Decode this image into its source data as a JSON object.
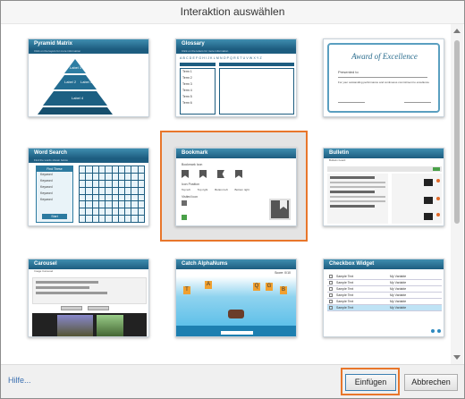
{
  "window": {
    "title": "Interaktion auswählen"
  },
  "tiles": [
    {
      "title": "Pyramid Matrix",
      "subtitle": "Click on the layers for more information",
      "labels": [
        "Label 1",
        "Label 2",
        "Label 3",
        "Label 4"
      ]
    },
    {
      "title": "Glossary",
      "subtitle": "Click on the letters for more information",
      "letters": "ABCDEFGHIJKLMNOPQRSTUVWXYZ",
      "terms": [
        "Term 1",
        "Term 2",
        "Term 3",
        "Term 4",
        "Term 5",
        "Term 6"
      ]
    },
    {
      "title": "Award of Excellence",
      "presented": "Presented to",
      "body": "For your outstanding performance and continuous commitment to excellence"
    },
    {
      "title": "Word Search",
      "subtitle": "Find the words shown below",
      "box_title": "Find These",
      "words": [
        "Keyword",
        "Keyword",
        "Keyword",
        "Keyword",
        "Keyword"
      ],
      "button": "Start"
    },
    {
      "title": "Bookmark",
      "lbl_style": "Bookmark Icon",
      "lbl_pos": "Icon Position",
      "opts": [
        "Top left",
        "Top right",
        "Bottom left",
        "Bottom right"
      ],
      "lbl_vis": "Visited Icon"
    },
    {
      "title": "Bulletin",
      "subtitle": "Bulletin board"
    },
    {
      "title": "Carousel",
      "subtitle": "Image Carousel"
    },
    {
      "title": "Catch AlphaNums",
      "score": "Score: 0/10",
      "letters": [
        "T",
        "A",
        "Q",
        "G",
        "B"
      ]
    },
    {
      "title": "Checkbox Widget",
      "items": [
        "Sample Text",
        "Sample Text",
        "Sample Text",
        "Sample Text",
        "Sample Text",
        "Sample Text"
      ],
      "values": [
        "My Variable",
        "My Variable",
        "My Variable",
        "My Variable",
        "My Variable",
        "My Variable"
      ]
    }
  ],
  "footer": {
    "help": "Hilfe...",
    "ok": "Einfügen",
    "cancel": "Abbrechen"
  },
  "colors": {
    "accent": "#e8762b",
    "header": "#1d5d80",
    "header_light": "#3f8eb0"
  }
}
